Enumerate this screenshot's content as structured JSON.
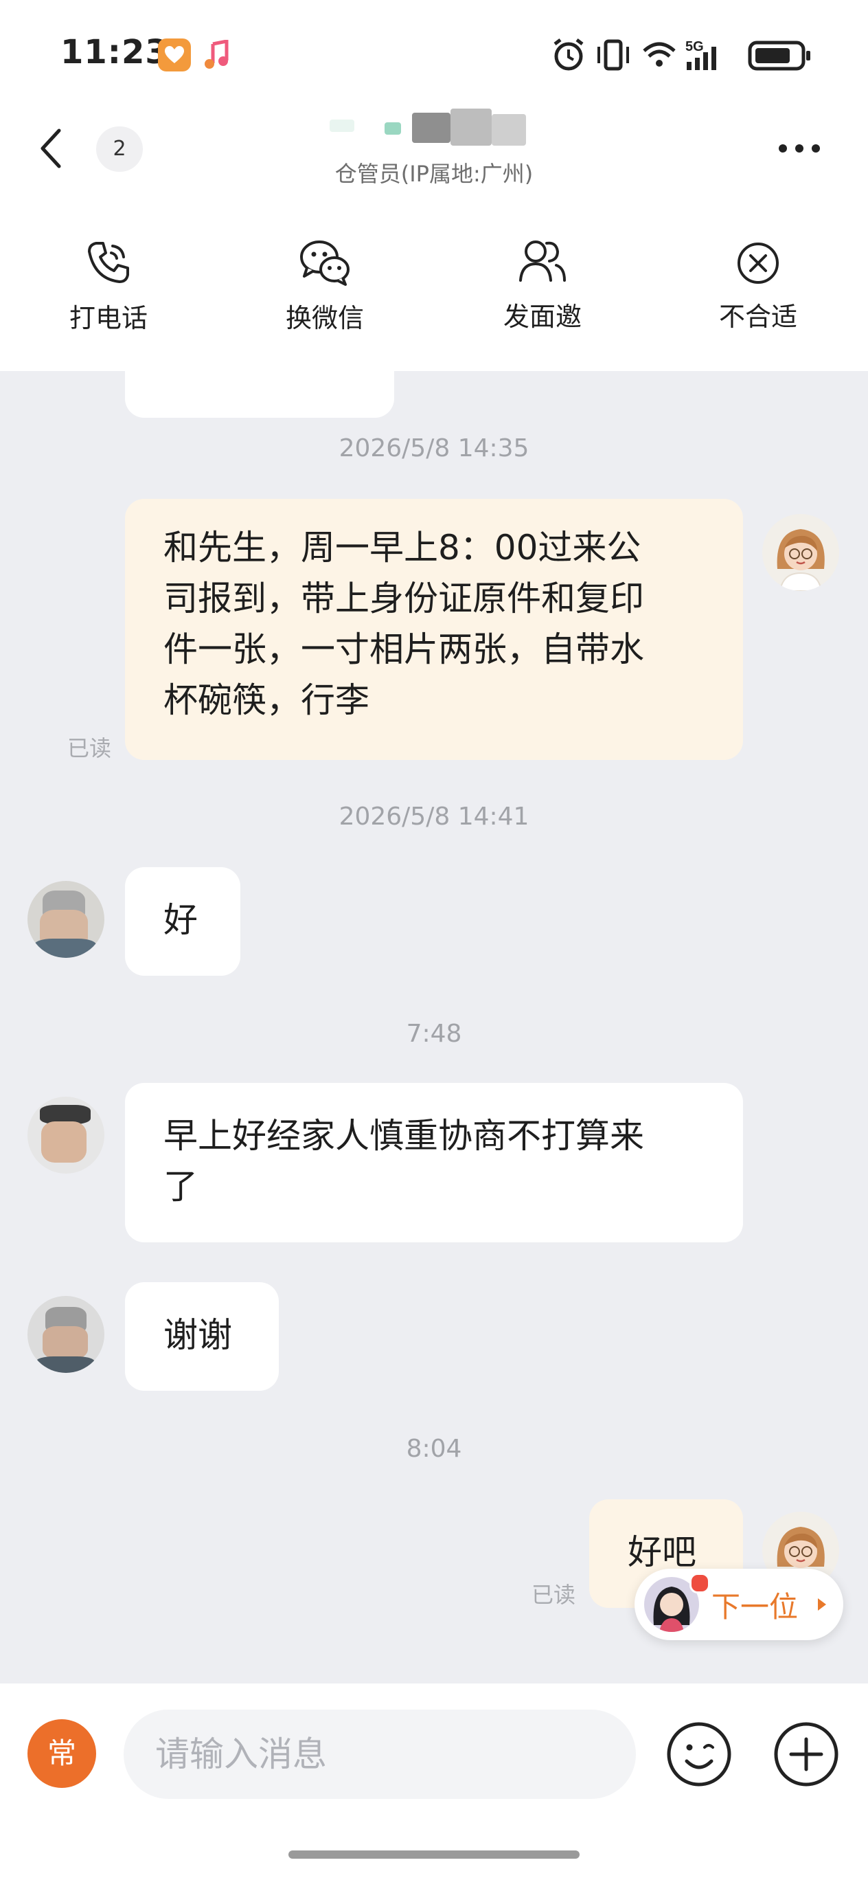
{
  "status_bar": {
    "time": "11:23",
    "network": "5G"
  },
  "header": {
    "unread_count": "2",
    "contact_subtitle": "仓管员(IP属地:广州)"
  },
  "actions": [
    {
      "label": "打电话",
      "icon": "phone-icon"
    },
    {
      "label": "换微信",
      "icon": "wechat-icon"
    },
    {
      "label": "发面邀",
      "icon": "people-icon"
    },
    {
      "label": "不合适",
      "icon": "close-circle-icon"
    }
  ],
  "messages": [
    {
      "type": "timestamp",
      "text": "2026/5/8 14:35"
    },
    {
      "type": "message",
      "sender": "me",
      "lines": [
        "和先生，周一早上8：00过来公",
        "司报到，带上身份证原件和复印",
        "件一张，一寸相片两张，自带水",
        "杯碗筷，行李"
      ],
      "status": "已读"
    },
    {
      "type": "timestamp",
      "text": "2026/5/8 14:41"
    },
    {
      "type": "message",
      "sender": "them",
      "lines": [
        "好"
      ]
    },
    {
      "type": "timestamp",
      "text": "7:48"
    },
    {
      "type": "message",
      "sender": "them",
      "lines": [
        "早上好经家人慎重协商不打算来",
        "了"
      ]
    },
    {
      "type": "message",
      "sender": "them",
      "lines": [
        "谢谢"
      ]
    },
    {
      "type": "timestamp",
      "text": "8:04"
    },
    {
      "type": "message",
      "sender": "me",
      "lines": [
        "好吧"
      ],
      "status": "已读"
    }
  ],
  "next_candidate": {
    "label": "下一位"
  },
  "input_bar": {
    "common_label": "常",
    "placeholder": "请输入消息"
  },
  "colors": {
    "accent": "#ec6f2a",
    "my_bubble": "#fdf4e6",
    "chat_bg": "#edeef2"
  }
}
